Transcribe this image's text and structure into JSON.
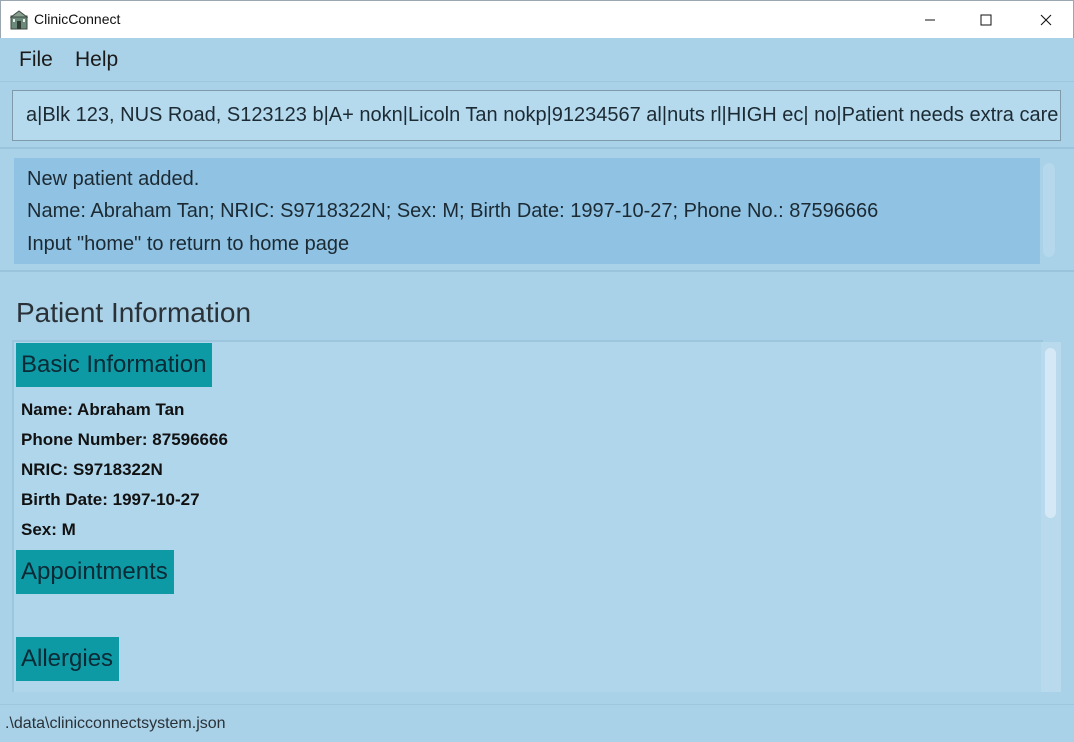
{
  "window": {
    "title": "ClinicConnect",
    "icon": "clinic-building-icon"
  },
  "menu": {
    "file": "File",
    "help": "Help"
  },
  "command": {
    "value": "a|Blk 123, NUS Road, S123123 b|A+ nokn|Licoln Tan nokp|91234567 al|nuts rl|HIGH ec| no|Patient needs extra care"
  },
  "result": {
    "line1": "New patient added.",
    "line2": "Name: Abraham Tan; NRIC: S9718322N; Sex: M; Birth Date: 1997-10-27; Phone No.: 87596666",
    "line3": "Input \"home\" to return to home page"
  },
  "patient": {
    "heading": "Patient Information",
    "basic_header": "Basic Information",
    "name": "Name: Abraham Tan",
    "phone": "Phone Number: 87596666",
    "nric": "NRIC: S9718322N",
    "birth_date": "Birth Date: 1997-10-27",
    "sex": "Sex: M",
    "appointments_header": "Appointments",
    "allergies_header": "Allergies"
  },
  "status": {
    "path": ".\\data\\clinicconnectsystem.json"
  },
  "colors": {
    "background": "#a9d1e7",
    "result_box": "#8fc2e3",
    "section_header": "#0e9aa4"
  }
}
